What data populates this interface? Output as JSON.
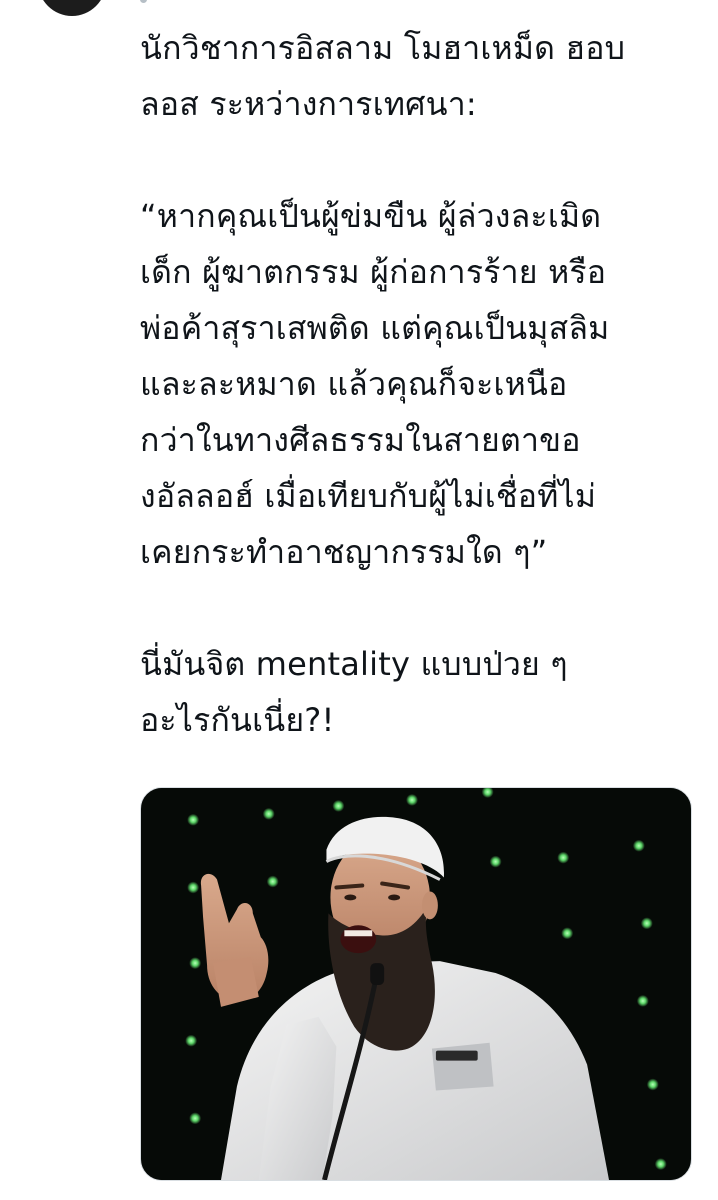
{
  "tweet": {
    "text_lines": [
      "นักวิชาการอิสลาม โมฮาเหม็ด ฮอบ",
      "ลอส ระหว่างการเทศนา:",
      "“หากคุณเป็นผู้ข่มขืน ผู้ล่วงละเมิด",
      "เด็ก ผู้ฆาตกรรม ผู้ก่อการร้าย หรือ",
      "พ่อค้าสุราเสพติด แต่คุณเป็นมุสลิม",
      "และละหมาด แล้วคุณก็จะเหนือ",
      "กว่าในทางศีลธรรมในสายตาขอ",
      "งอัลลอฮ์ เมื่อเทียบกับผู้ไม่เชื่อที่ไม่",
      "เคยกระทำอาชญากรรมใด ๆ”",
      "นี่มันจิต mentality แบบป่วย ๆ",
      "อะไรกันเนี่ย?!"
    ]
  },
  "media": {
    "icon": "speaker-photo"
  },
  "colors": {
    "text": "#0f1419",
    "background": "#ffffff",
    "media_background": "#070b08",
    "stage_lights": "#6fe07a"
  }
}
